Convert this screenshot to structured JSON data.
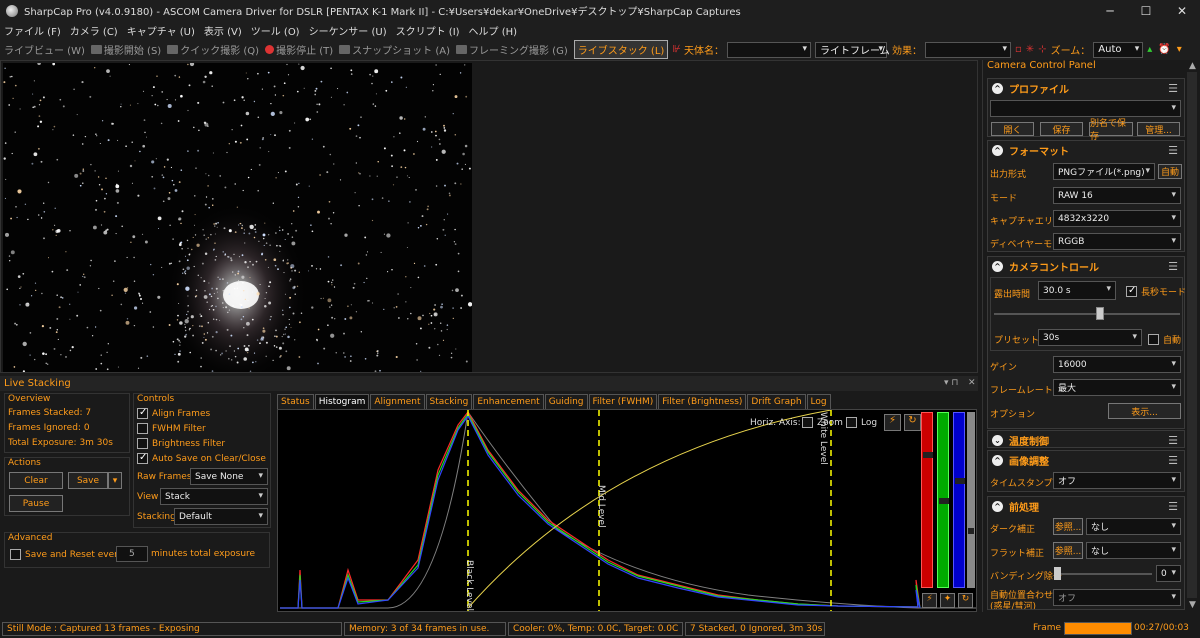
{
  "window": {
    "title": "SharpCap Pro (v4.0.9180) - ASCOM Camera Driver for DSLR [PENTAX K-1 Mark II] - C:¥Users¥dekar¥OneDrive¥デスクトップ¥SharpCap Captures"
  },
  "menu": [
    "ファイル (F)",
    "カメラ (C)",
    "キャプチャ (U)",
    "表示 (V)",
    "ツール (O)",
    "シーケンサー (U)",
    "スクリプト (I)",
    "ヘルプ (H)"
  ],
  "toolbar": {
    "live_view": "ライブビュー (W)",
    "start_capture": "撮影開始 (S)",
    "quick_capture": "クイック撮影 (Q)",
    "stop_capture": "撮影停止 (T)",
    "snapshot": "スナップショット (A)",
    "framing": "フレーミング撮影 (G)",
    "live_stack": "ライブスタック (L)",
    "target_label": "天体名：",
    "target_value": "",
    "frame_type": "ライトフレーム",
    "effect_label": "効果：",
    "effect_value": "",
    "zoom_label": "ズーム：",
    "zoom_value": "Auto"
  },
  "right_panel": {
    "title": "Camera Control Panel",
    "profile": {
      "title": "プロファイル",
      "value": "",
      "buttons": [
        "開く",
        "保存",
        "別名で保存",
        "管理..."
      ]
    },
    "format": {
      "title": "フォーマット",
      "output_label": "出力形式",
      "output_value": "PNGファイル(*.png)",
      "auto_btn": "自動",
      "mode_label": "モード",
      "mode_value": "RAW 16",
      "area_label": "キャプチャエリア",
      "area_value": "4832x3220",
      "debayer_label": "ディベイヤーモード",
      "debayer_value": "RGGB"
    },
    "camera": {
      "title": "カメラコントロール",
      "exposure_label": "露出時間",
      "exposure_value": "30.0 s",
      "long_label": "長秒モード",
      "preset_label": "プリセット",
      "preset_value": "30s",
      "auto_label": "自動",
      "gain_label": "ゲイン",
      "gain_value": "16000",
      "framerate_label": "フレームレート",
      "framerate_value": "最大",
      "options_label": "オプション",
      "options_btn": "表示..."
    },
    "temp": {
      "title": "温度制御"
    },
    "image": {
      "title": "画像調整",
      "timestamp_label": "タイムスタンプ",
      "timestamp_value": "オフ"
    },
    "preproc": {
      "title": "前処理",
      "dark_label": "ダーク補正",
      "dark_btn": "参照...",
      "dark_value": "なし",
      "flat_label": "フラット補正",
      "flat_btn": "参照...",
      "flat_value": "なし",
      "banding_label": "バンディング除去",
      "banding_value": "0",
      "align_label1": "自動位置合わせ",
      "align_label2": "(惑星/彗河)",
      "align_value": "オフ"
    }
  },
  "live_stacking": {
    "title": "Live Stacking",
    "overview": {
      "title": "Overview",
      "stacked": "Frames Stacked: 7",
      "ignored": "Frames Ignored: 0",
      "exposure": "Total Exposure:   3m 30s"
    },
    "actions": {
      "title": "Actions",
      "clear": "Clear",
      "save": "Save",
      "pause": "Pause"
    },
    "advanced": {
      "title": "Advanced",
      "save_reset": "Save and Reset every",
      "minutes_value": "5",
      "minutes_label": "minutes total exposure"
    },
    "controls": {
      "title": "Controls",
      "align": "Align Frames",
      "fwhm": "FWHM Filter",
      "brightness": "Brightness Filter",
      "autosave": "Auto Save on Clear/Close",
      "raw_label": "Raw Frames",
      "raw_value": "Save None",
      "view_label": "View",
      "view_value": "Stack",
      "stacking_label": "Stacking",
      "stacking_value": "Default"
    },
    "tabs": [
      "Status",
      "Histogram",
      "Alignment",
      "Stacking",
      "Enhancement",
      "Guiding",
      "Filter (FWHM)",
      "Filter (Brightness)",
      "Drift Graph",
      "Log"
    ],
    "histogram": {
      "horiz_axis": "Horiz. Axis:",
      "zoom": "Zoom",
      "log": "Log",
      "black_level": "Black Level",
      "mid_level": "Mid Level",
      "white_level": "White Level"
    }
  },
  "status": {
    "mode": "Still Mode : Captured 13 frames - Exposing",
    "memory": "Memory: 3 of 34 frames in use.",
    "cooler": "Cooler: 0%, Temp: 0.0C, Target: 0.0C",
    "stacked": "7 Stacked, 0 Ignored, 3m 30s",
    "frame_label": "Frame :",
    "progress": 1.0,
    "time": "00:27/00:03"
  },
  "colors": {
    "accent": "#ff9c1a",
    "panel": "#1e1e1e",
    "background": "#1a1a1a"
  }
}
